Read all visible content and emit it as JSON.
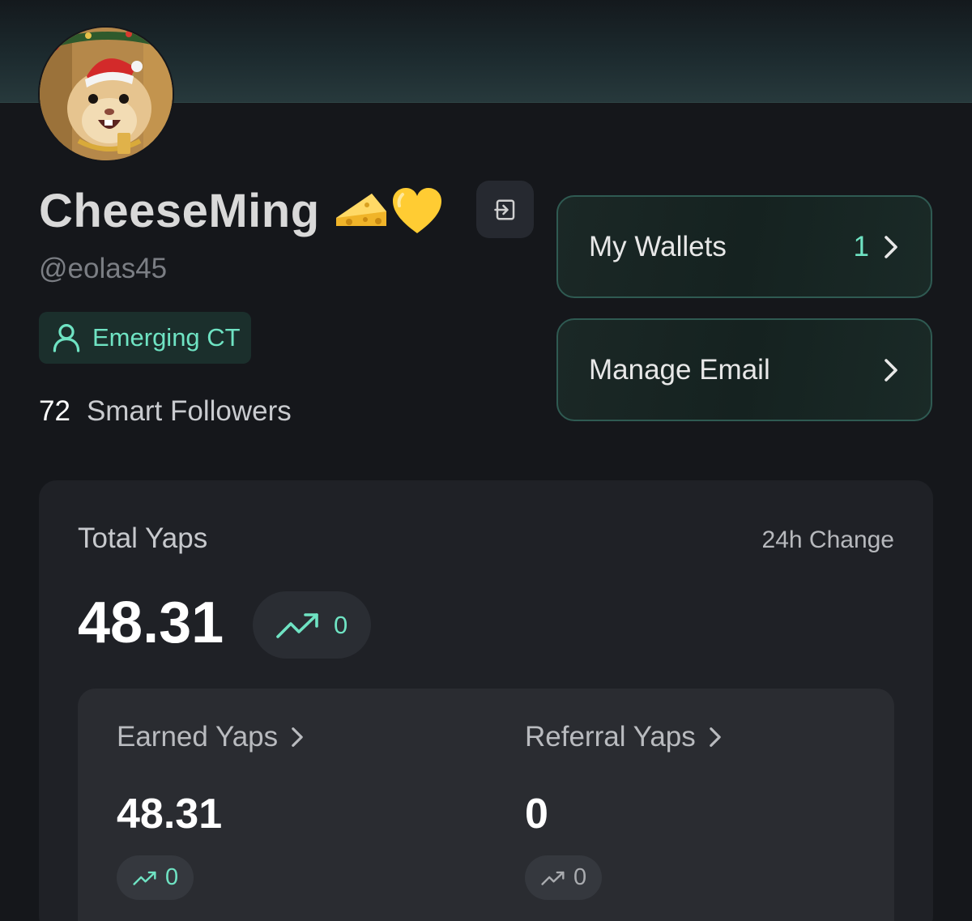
{
  "profile": {
    "display_name": "CheeseMing",
    "handle": "@eolas45",
    "tier": "Emerging CT",
    "smart_followers_count": "72",
    "smart_followers_label": "Smart Followers"
  },
  "actions": {
    "wallets_label": "My Wallets",
    "wallets_count": "1",
    "email_label": "Manage Email"
  },
  "stats": {
    "total_label": "Total Yaps",
    "change_label": "24h Change",
    "total_value": "48.31",
    "total_change": "0",
    "earned_label": "Earned Yaps",
    "earned_value": "48.31",
    "earned_change": "0",
    "referral_label": "Referral Yaps",
    "referral_value": "0",
    "referral_change": "0"
  },
  "colors": {
    "accent": "#6fe3c3",
    "background": "#15171b",
    "card": "#1f2126"
  },
  "icons": [
    "avatar-hamster",
    "cheese-emoji",
    "yellow-heart-emoji",
    "login-icon",
    "user-icon",
    "chevron-right-icon",
    "trend-up-icon"
  ]
}
